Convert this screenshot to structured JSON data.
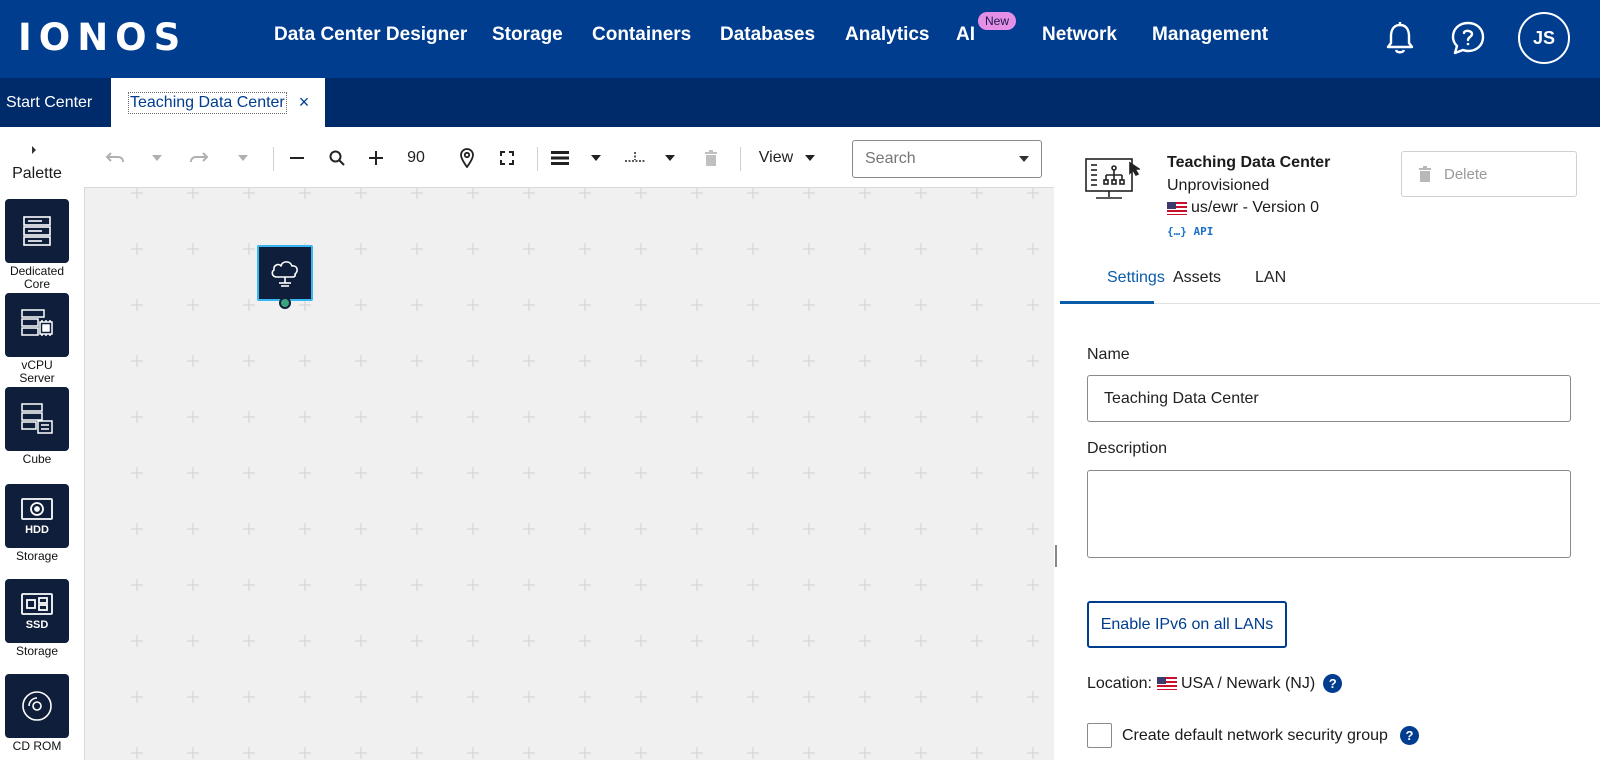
{
  "brand": {
    "logo_text": "IONOS"
  },
  "nav": {
    "items": [
      "Data Center Designer",
      "Storage",
      "Containers",
      "Databases",
      "Analytics",
      "AI",
      "Network",
      "Management"
    ],
    "new_badge": "New",
    "avatar_initials": "JS"
  },
  "tabs": {
    "start": "Start Center",
    "active": "Teaching Data Center",
    "close_glyph": "×"
  },
  "palette": {
    "title": "Palette",
    "items": [
      {
        "icon": "dedicated-core-server-icon",
        "tag": "",
        "label_line1": "Dedicated",
        "label_line2": "Core"
      },
      {
        "icon": "vcpu-server-icon",
        "tag": "",
        "label_line1": "vCPU",
        "label_line2": "Server"
      },
      {
        "icon": "cube-icon",
        "tag": "",
        "label_line1": "Cube",
        "label_line2": ""
      },
      {
        "icon": "hdd-storage-icon",
        "tag": "HDD",
        "label_line1": "Storage",
        "label_line2": ""
      },
      {
        "icon": "ssd-storage-icon",
        "tag": "SSD",
        "label_line1": "Storage",
        "label_line2": ""
      },
      {
        "icon": "cd-rom-icon",
        "tag": "",
        "label_line1": "CD ROM",
        "label_line2": ""
      }
    ]
  },
  "toolbar": {
    "zoom_level": "90",
    "view_label": "View",
    "search_placeholder": "Search"
  },
  "canvas": {
    "nodes": [
      {
        "type": "internet-access",
        "icon": "cloud-internet-icon",
        "selected": true,
        "status_color": "#3aa57c"
      }
    ]
  },
  "panel": {
    "dc_name": "Teaching Data Center",
    "status": "Unprovisioned",
    "region": "us/ewr - Version 0",
    "api_link": "{…} API",
    "delete_label": "Delete",
    "tabs": [
      "Settings",
      "Assets",
      "LAN"
    ],
    "active_tab": "Settings",
    "name_label": "Name",
    "name_value": "Teaching Data Center",
    "description_label": "Description",
    "description_value": "",
    "ipv6_button": "Enable IPv6 on all LANs",
    "location_label": "Location:",
    "location_value": "USA / Newark (NJ)",
    "security_group_label": "Create default network security group",
    "security_group_checked": false
  },
  "colors": {
    "nav_bg": "#003d8f",
    "tabbar_bg": "#002b6b",
    "accent": "#0b5ca8",
    "new_badge": "#e58fe6",
    "tile_bg": "#0f1e3a"
  }
}
